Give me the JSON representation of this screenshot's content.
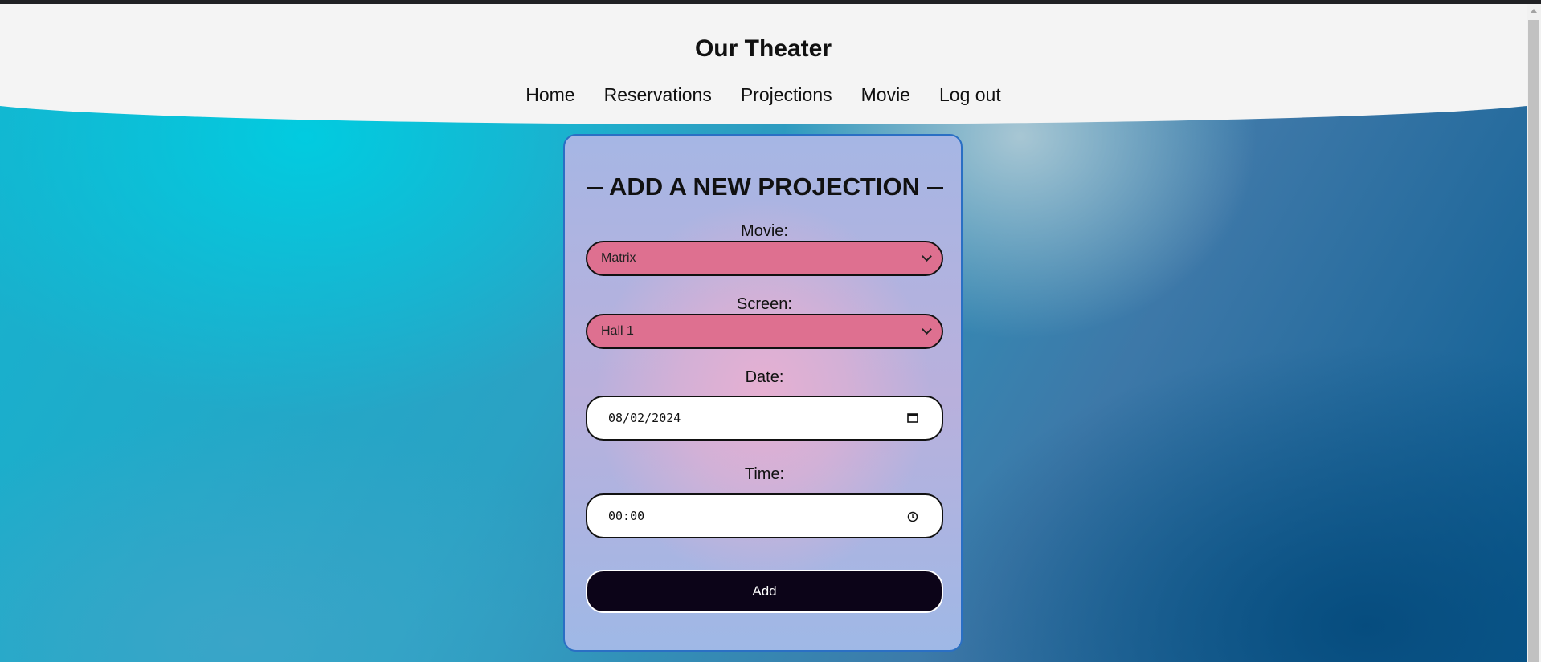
{
  "header": {
    "title": "Our Theater",
    "nav": [
      "Home",
      "Reservations",
      "Projections",
      "Movie",
      "Log out"
    ]
  },
  "form": {
    "title": "ADD A NEW PROJECTION",
    "movie_label": "Movie:",
    "movie_value": "Matrix",
    "screen_label": "Screen:",
    "screen_value": "Hall 1",
    "date_label": "Date:",
    "date_value": "08/02/2024",
    "time_label": "Time:",
    "time_value": "00:00",
    "submit_label": "Add"
  },
  "colors": {
    "select_bg": "#de7090",
    "button_bg": "#0c0418",
    "card_border": "#2a6fc4",
    "header_bg": "#f4f4f4"
  }
}
